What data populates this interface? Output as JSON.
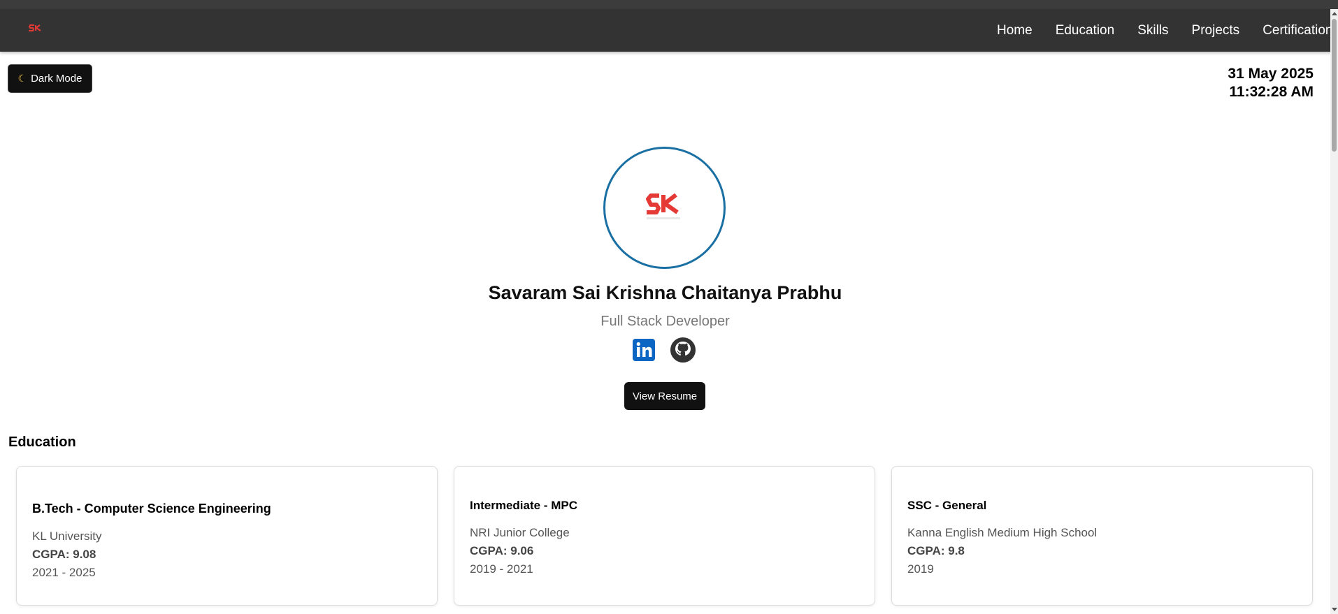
{
  "nav": {
    "logo_icon": "sk-logo-icon",
    "links": [
      "Home",
      "Education",
      "Skills",
      "Projects",
      "Certifications"
    ]
  },
  "theme_toggle": {
    "icon": "moon-icon",
    "label": "Dark Mode"
  },
  "datetime": {
    "date": "31 May 2025",
    "time": "11:32:28 AM"
  },
  "profile": {
    "avatar_icon": "sk-logo-icon",
    "name": "Savaram Sai Krishna Chaitanya Prabhu",
    "role": "Full Stack Developer",
    "socials": [
      {
        "icon": "linkedin-icon",
        "color": "#0a66c2"
      },
      {
        "icon": "github-icon",
        "color": "#333333"
      }
    ],
    "resume_label": "View Resume"
  },
  "education": {
    "title": "Education",
    "cards": [
      {
        "degree": "B.Tech - Computer Science Engineering",
        "institution": "KL University",
        "cgpa": "CGPA: 9.08",
        "years": "2021 - 2025"
      },
      {
        "degree": "Intermediate - MPC",
        "institution": "NRI Junior College",
        "cgpa": "CGPA: 9.06",
        "years": "2019 - 2021"
      },
      {
        "degree": "SSC - General",
        "institution": "Kanna English Medium High School",
        "cgpa": "CGPA: 9.8",
        "years": "2019"
      }
    ]
  },
  "colors": {
    "navbar": "#333333",
    "accent_ring": "#1a6fa3",
    "logo_red": "#e53935",
    "button": "#111111"
  }
}
